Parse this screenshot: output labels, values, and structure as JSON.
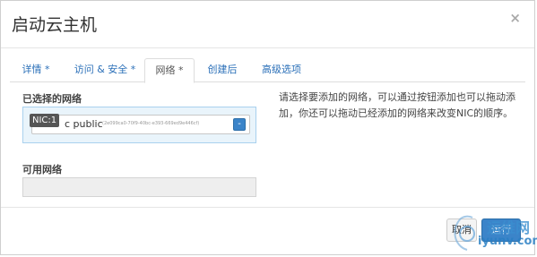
{
  "dialog": {
    "title": "启动云主机",
    "close_symbol": "×"
  },
  "tabs": [
    {
      "label": "详情 *",
      "active": false
    },
    {
      "label": "访问 & 安全 *",
      "active": false
    },
    {
      "label": "网络 *",
      "active": true
    },
    {
      "label": "创建后",
      "active": false
    },
    {
      "label": "高级选项",
      "active": false
    }
  ],
  "selected_networks": {
    "label": "已选择的网络",
    "items": [
      {
        "nic": "NIC:1",
        "name": "c public",
        "id": "(2e099ca0-70f9-40bc-e393-669ed9e446cf)",
        "button": "-"
      }
    ]
  },
  "help_text": "请选择要添加的网络，可以通过按钮添加也可以拖动添加，你还可以拖动已经添加的网络来改变NIC的顺序。",
  "available_networks": {
    "label": "可用网络"
  },
  "footer": {
    "cancel_label": "取消",
    "launch_label": "运行"
  },
  "watermark": {
    "line1": "运维网",
    "line2": "iyunv.com"
  },
  "colors": {
    "link": "#2a6fb8",
    "primary": "#3b84c9",
    "selected_bg": "#e9f4fb"
  }
}
